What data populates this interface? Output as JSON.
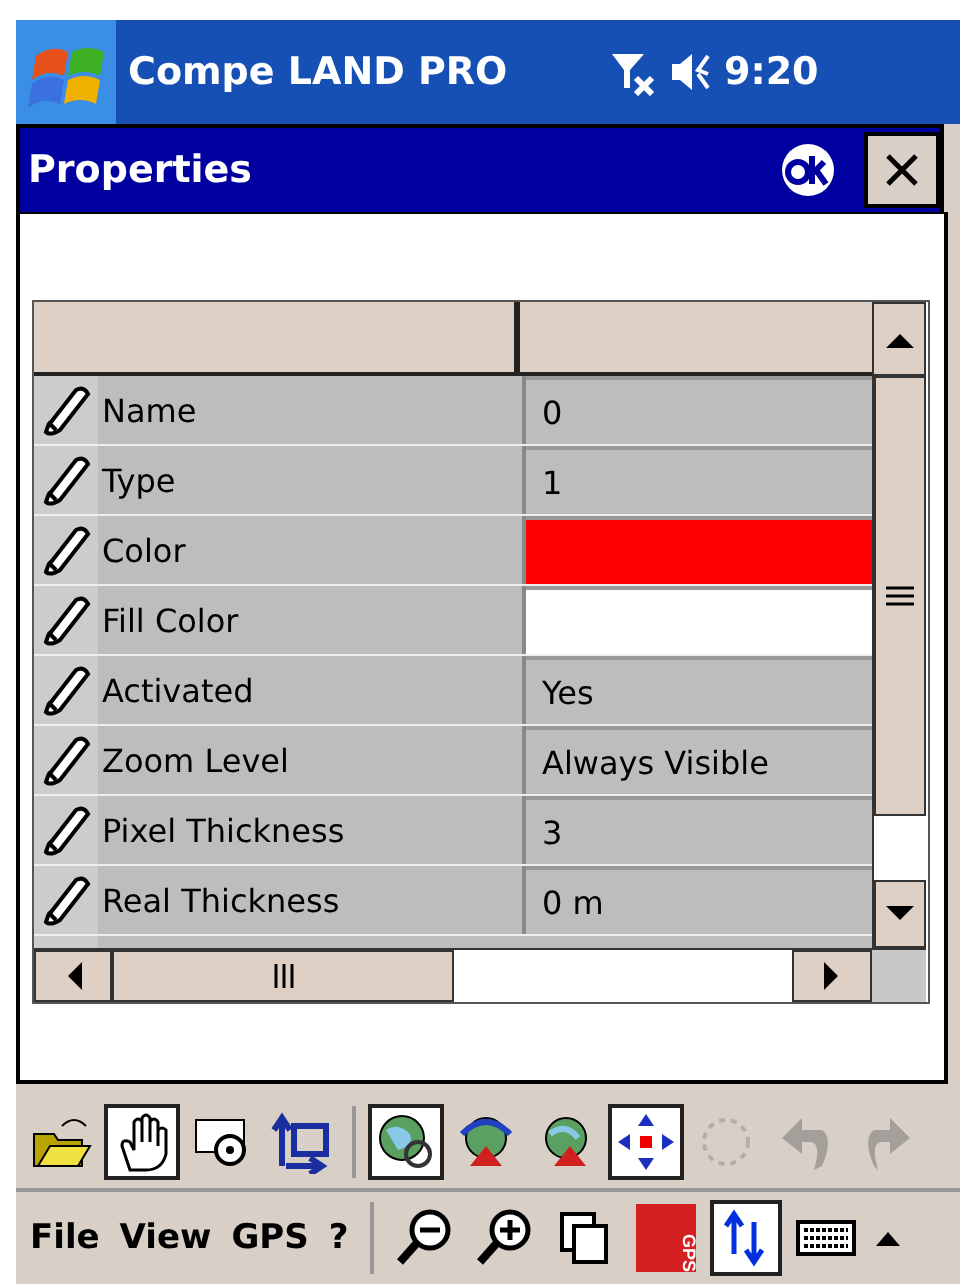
{
  "status_bar": {
    "app_title": "Compe LAND PRO",
    "time": "9:20"
  },
  "dialog": {
    "title": "Properties"
  },
  "properties": [
    {
      "label": "Name",
      "kind": "text",
      "value": "0"
    },
    {
      "label": "Type",
      "kind": "text",
      "value": "1"
    },
    {
      "label": "Color",
      "kind": "color",
      "color": "#ff0000"
    },
    {
      "label": "Fill Color",
      "kind": "color",
      "color": "#ffffff"
    },
    {
      "label": "Activated",
      "kind": "text",
      "value": "Yes"
    },
    {
      "label": "Zoom Level",
      "kind": "text",
      "value": "Always Visible"
    },
    {
      "label": "Pixel Thickness",
      "kind": "text",
      "value": "3"
    },
    {
      "label": "Real Thickness",
      "kind": "text",
      "value": "0 m"
    },
    {
      "kind": "partial"
    }
  ],
  "toolbar": [
    {
      "pressed": false,
      "disabled": false
    },
    {
      "pressed": true,
      "disabled": false
    },
    {
      "pressed": false,
      "disabled": false
    },
    {
      "pressed": false,
      "disabled": false
    },
    {
      "pressed": true,
      "disabled": false
    },
    {
      "pressed": false,
      "disabled": false
    },
    {
      "pressed": false,
      "disabled": false
    },
    {
      "pressed": true,
      "disabled": false
    },
    {
      "pressed": false,
      "disabled": true
    },
    {
      "pressed": false,
      "disabled": true
    },
    {
      "pressed": false,
      "disabled": true
    }
  ],
  "menu": [
    "File",
    "View",
    "GPS",
    "?"
  ],
  "menu_tools": [
    {
      "pressed": false
    },
    {
      "pressed": false
    },
    {
      "pressed": false
    },
    {
      "pressed": false,
      "label": "GPS"
    },
    {
      "pressed": true
    },
    {
      "pressed": false
    }
  ]
}
